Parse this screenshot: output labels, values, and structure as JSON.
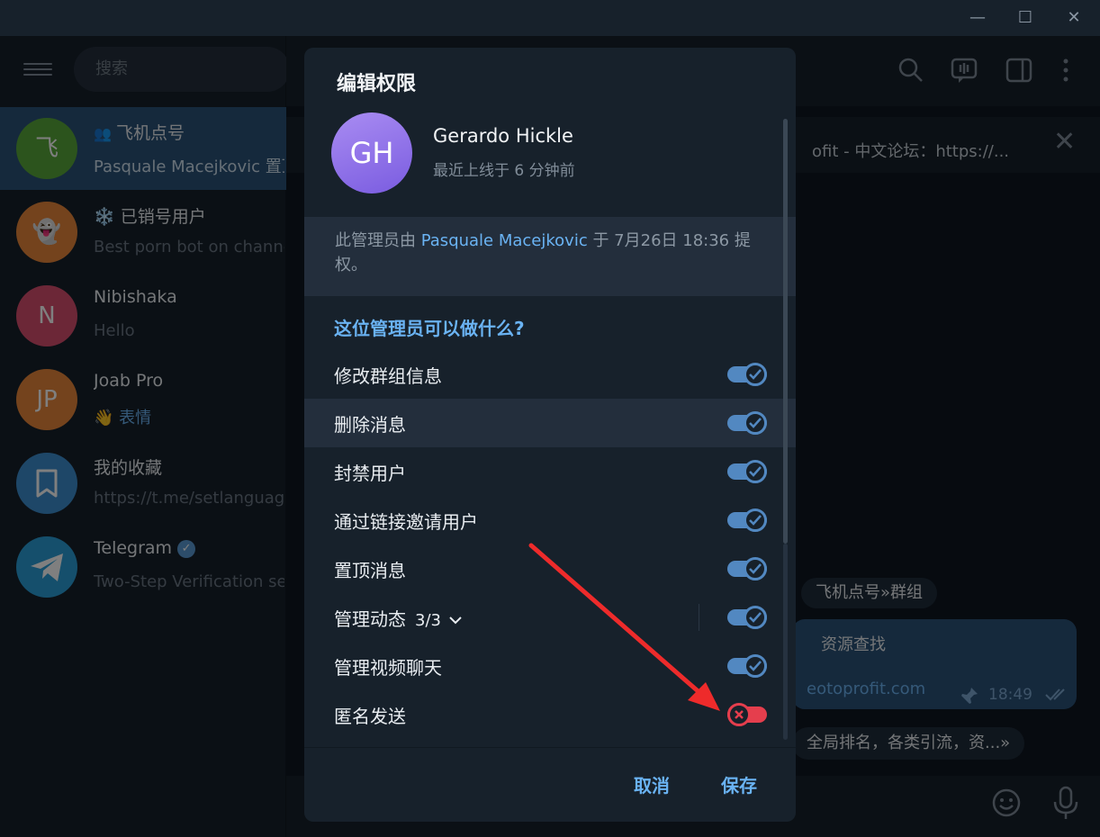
{
  "search": {
    "placeholder": "搜索"
  },
  "chats": [
    {
      "avatar_text": "飞",
      "avatar_color": "#58a83b",
      "name": "飞机点号",
      "message": "Pasquale Macejkovic 置顶了",
      "active": true
    },
    {
      "avatar_text": "👻",
      "avatar_color": "#e8873a",
      "name": "❄️ 已销号用户",
      "message": "Best porn bot on channel"
    },
    {
      "avatar_text": "N",
      "avatar_color": "#d84e6f",
      "name": "Nibishaka",
      "message": "Hello"
    },
    {
      "avatar_text": "JP",
      "avatar_color": "#e8873a",
      "name": "Joab Pro",
      "message_emoji": "👋",
      "message": "表情"
    },
    {
      "avatar_text": "",
      "avatar_color": "#3d8fd1",
      "name": "我的收藏",
      "message": "https://t.me/setlanguage"
    },
    {
      "avatar_text": "",
      "avatar_color": "#2a9fd8",
      "name": "Telegram",
      "message": "Two-Step Verification se"
    }
  ],
  "pinned": {
    "text": "ofit - 中文论坛：https://..."
  },
  "messages": {
    "service1": "飞机点号»群组",
    "bubble_title": "资源查找",
    "bubble_link": "eotoprofit.com",
    "bubble_time": "18:49",
    "service2": "全局排名，各类引流，资...»"
  },
  "dialog": {
    "title": "编辑权限",
    "user": {
      "initials": "GH",
      "name": "Gerardo Hickle",
      "status": "最近上线于 6 分钟前"
    },
    "promoted_prefix": "此管理员由 ",
    "promoted_by": "Pasquale Macejkovic",
    "promoted_suffix": " 于 7月26日 18:36 提权。",
    "section_title": "这位管理员可以做什么?",
    "permissions": [
      {
        "label": "修改群组信息",
        "enabled": true
      },
      {
        "label": "删除消息",
        "enabled": true
      },
      {
        "label": "封禁用户",
        "enabled": true
      },
      {
        "label": "通过链接邀请用户",
        "enabled": true
      },
      {
        "label": "置顶消息",
        "enabled": true
      },
      {
        "label": "管理动态",
        "count": "3/3",
        "enabled": true
      },
      {
        "label": "管理视频聊天",
        "enabled": true
      },
      {
        "label": "匿名发送",
        "enabled": false
      }
    ],
    "cancel_label": "取消",
    "save_label": "保存"
  }
}
